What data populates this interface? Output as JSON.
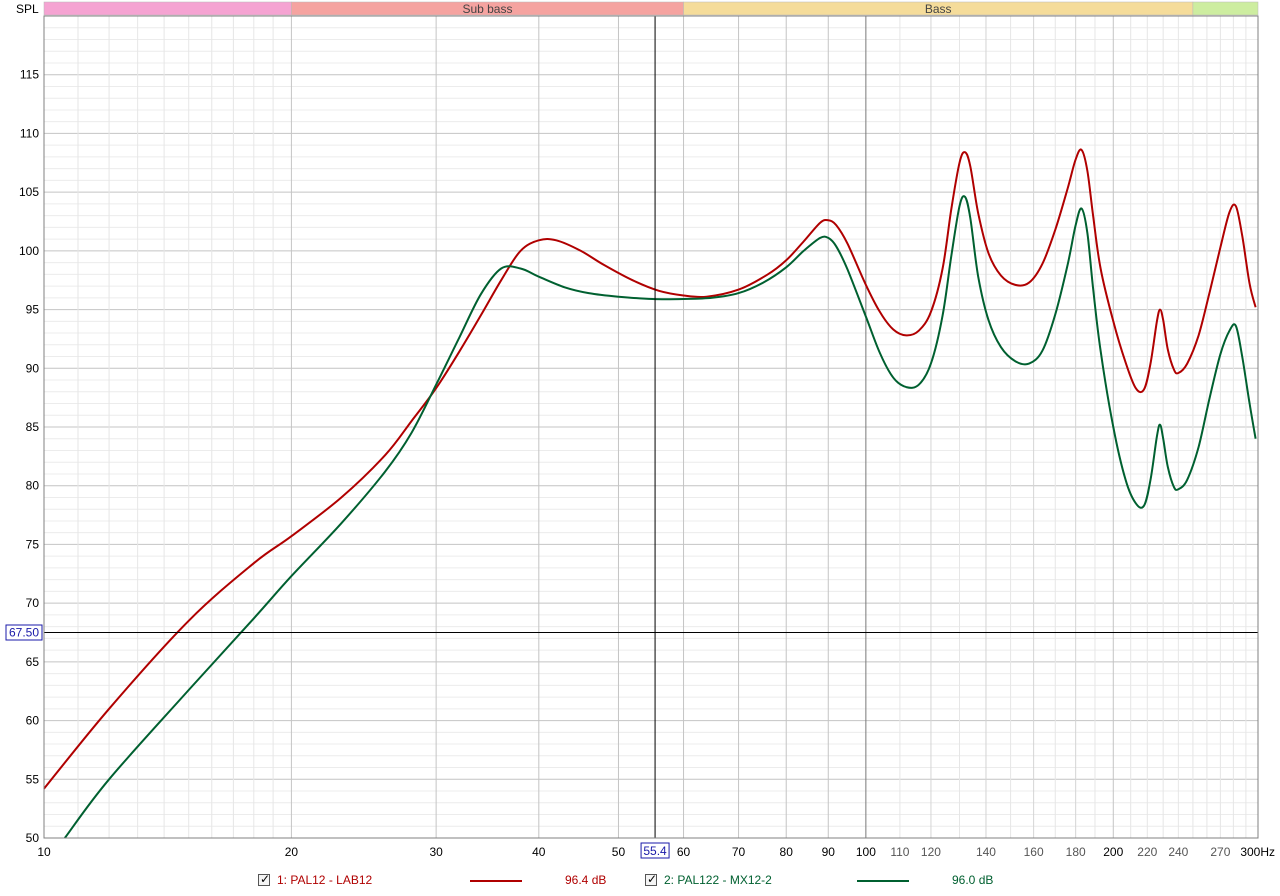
{
  "chart_data": {
    "type": "line",
    "ylabel": "SPL",
    "xunit": "Hz",
    "x_scale": "log",
    "xlim": [
      10,
      300
    ],
    "ylim": [
      50,
      120
    ],
    "y_ticks": [
      50,
      55,
      60,
      65,
      70,
      75,
      80,
      85,
      90,
      95,
      100,
      105,
      110,
      115
    ],
    "x_ticks_major": [
      10,
      20,
      30,
      40,
      50,
      60,
      70,
      80,
      90,
      100,
      200
    ],
    "x_ticks_minor": [
      110,
      120,
      140,
      160,
      180,
      220,
      240,
      270,
      300
    ],
    "x_tick_labels": {
      "10": "10",
      "20": "20",
      "30": "30",
      "40": "40",
      "50": "50",
      "60": "60",
      "70": "70",
      "80": "80",
      "90": "90",
      "100": "100",
      "110": "110",
      "120": "120",
      "140": "140",
      "160": "160",
      "180": "180",
      "200": "200",
      "220": "220",
      "240": "240",
      "270": "270",
      "300": "300Hz"
    },
    "grid": true,
    "bands": [
      {
        "label": "",
        "from": 10,
        "to": 20,
        "color": "#f5a3d2"
      },
      {
        "label": "Sub bass",
        "from": 20,
        "to": 60,
        "color": "#f5a3a0"
      },
      {
        "label": "Bass",
        "from": 60,
        "to": 250,
        "color": "#f5dc9a"
      },
      {
        "label": "",
        "from": 250,
        "to": 300,
        "color": "#cdeda0"
      }
    ],
    "cursor": {
      "x": 55.4,
      "y": 67.5,
      "x_label": "55.4",
      "y_label": "67.50"
    },
    "series": [
      {
        "name": "1: PAL12 - LAB12",
        "value": "96.4 dB",
        "color": "#b00000",
        "points": [
          [
            10,
            54.2
          ],
          [
            12,
            61
          ],
          [
            15,
            68.5
          ],
          [
            18,
            73.4
          ],
          [
            20,
            75.7
          ],
          [
            23,
            79
          ],
          [
            26,
            82.6
          ],
          [
            28,
            85.5
          ],
          [
            30,
            88.3
          ],
          [
            32,
            91.4
          ],
          [
            34,
            94.5
          ],
          [
            36,
            97.5
          ],
          [
            38,
            100.0
          ],
          [
            40,
            100.9
          ],
          [
            42,
            100.9
          ],
          [
            45,
            100.0
          ],
          [
            48,
            98.8
          ],
          [
            52,
            97.5
          ],
          [
            56,
            96.6
          ],
          [
            60,
            96.2
          ],
          [
            64,
            96.1
          ],
          [
            70,
            96.7
          ],
          [
            76,
            98.0
          ],
          [
            80,
            99.2
          ],
          [
            84,
            100.8
          ],
          [
            88,
            102.4
          ],
          [
            90,
            102.6
          ],
          [
            92,
            102.2
          ],
          [
            95,
            100.6
          ],
          [
            100,
            97.1
          ],
          [
            104,
            94.8
          ],
          [
            108,
            93.3
          ],
          [
            112,
            92.8
          ],
          [
            116,
            93.2
          ],
          [
            120,
            94.8
          ],
          [
            124,
            98.5
          ],
          [
            127,
            103.5
          ],
          [
            130,
            107.5
          ],
          [
            132,
            108.4
          ],
          [
            134,
            107.2
          ],
          [
            137,
            103.2
          ],
          [
            141,
            99.8
          ],
          [
            146,
            97.9
          ],
          [
            152,
            97.1
          ],
          [
            158,
            97.3
          ],
          [
            164,
            98.9
          ],
          [
            170,
            101.8
          ],
          [
            176,
            105.3
          ],
          [
            180,
            107.8
          ],
          [
            183,
            108.6
          ],
          [
            186,
            106.8
          ],
          [
            189,
            103
          ],
          [
            193,
            98.5
          ],
          [
            200,
            94
          ],
          [
            207,
            90.5
          ],
          [
            213,
            88.3
          ],
          [
            218,
            88.2
          ],
          [
            222,
            90.4
          ],
          [
            226,
            94
          ],
          [
            228,
            95
          ],
          [
            230,
            94.1
          ],
          [
            233,
            91.6
          ],
          [
            237,
            89.9
          ],
          [
            240,
            89.6
          ],
          [
            246,
            90.4
          ],
          [
            254,
            92.8
          ],
          [
            262,
            96.5
          ],
          [
            270,
            100.3
          ],
          [
            277,
            103.3
          ],
          [
            282,
            103.8
          ],
          [
            287,
            101.3
          ],
          [
            293,
            97.2
          ],
          [
            298,
            95.2
          ]
        ]
      },
      {
        "name": "2: PAL122 - MX12-2",
        "value": "96.0 dB",
        "color": "#006030",
        "points": [
          [
            10.6,
            50
          ],
          [
            12,
            55
          ],
          [
            15,
            62.6
          ],
          [
            18,
            68.7
          ],
          [
            20,
            72.3
          ],
          [
            23,
            76.8
          ],
          [
            26,
            81.2
          ],
          [
            28,
            84.5
          ],
          [
            30,
            88.6
          ],
          [
            32,
            92.6
          ],
          [
            34,
            96.3
          ],
          [
            36,
            98.5
          ],
          [
            38,
            98.5
          ],
          [
            40,
            97.8
          ],
          [
            43,
            96.9
          ],
          [
            46,
            96.4
          ],
          [
            50,
            96.1
          ],
          [
            55,
            95.9
          ],
          [
            60,
            95.9
          ],
          [
            65,
            96.0
          ],
          [
            70,
            96.4
          ],
          [
            75,
            97.3
          ],
          [
            80,
            98.6
          ],
          [
            84,
            100
          ],
          [
            88,
            101.1
          ],
          [
            90,
            101.1
          ],
          [
            92,
            100.4
          ],
          [
            95,
            98.4
          ],
          [
            100,
            94.4
          ],
          [
            104,
            91.3
          ],
          [
            108,
            89.2
          ],
          [
            112,
            88.4
          ],
          [
            116,
            88.6
          ],
          [
            120,
            90.4
          ],
          [
            124,
            94.5
          ],
          [
            127,
            99.5
          ],
          [
            130,
            103.8
          ],
          [
            132,
            104.6
          ],
          [
            134,
            102.8
          ],
          [
            137,
            97.8
          ],
          [
            141,
            94.1
          ],
          [
            146,
            91.8
          ],
          [
            152,
            90.6
          ],
          [
            158,
            90.4
          ],
          [
            164,
            91.5
          ],
          [
            170,
            94.6
          ],
          [
            176,
            98.8
          ],
          [
            180,
            102.2
          ],
          [
            183,
            103.6
          ],
          [
            186,
            101.5
          ],
          [
            189,
            96.8
          ],
          [
            193,
            91.5
          ],
          [
            200,
            85
          ],
          [
            207,
            80.5
          ],
          [
            213,
            78.5
          ],
          [
            218,
            78.3
          ],
          [
            222,
            80.5
          ],
          [
            226,
            84.2
          ],
          [
            228,
            85.2
          ],
          [
            230,
            84
          ],
          [
            233,
            81.6
          ],
          [
            237,
            79.9
          ],
          [
            240,
            79.7
          ],
          [
            246,
            80.5
          ],
          [
            254,
            83.3
          ],
          [
            262,
            87.5
          ],
          [
            270,
            91.2
          ],
          [
            277,
            93.2
          ],
          [
            282,
            93.6
          ],
          [
            287,
            91
          ],
          [
            293,
            87
          ],
          [
            298,
            84
          ]
        ]
      }
    ]
  }
}
